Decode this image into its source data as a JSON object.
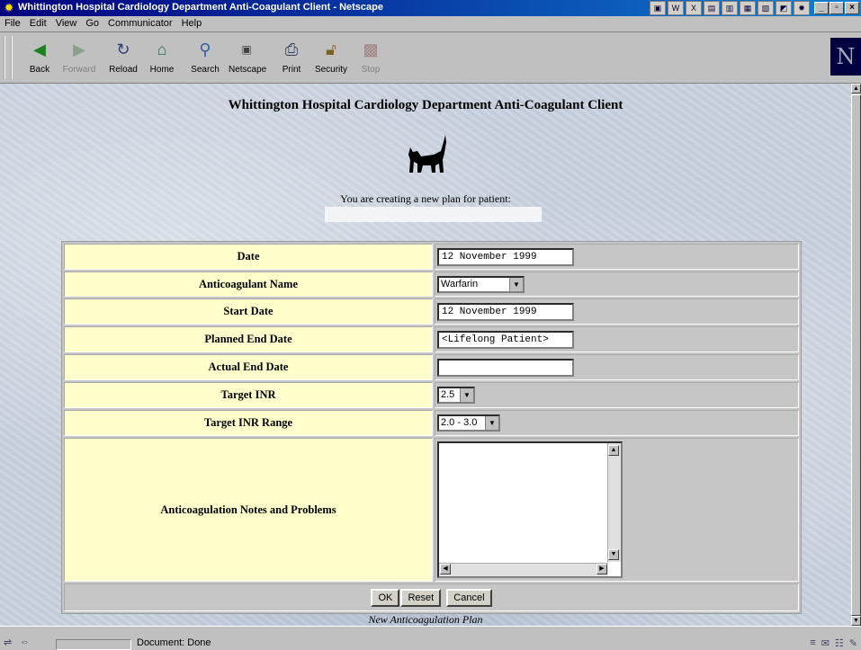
{
  "window": {
    "title": "Whittington Hospital Cardiology Department Anti-Coagulant Client - Netscape"
  },
  "menu": [
    "File",
    "Edit",
    "View",
    "Go",
    "Communicator",
    "Help"
  ],
  "toolbar": {
    "back": "Back",
    "forward": "Forward",
    "reload": "Reload",
    "home": "Home",
    "search": "Search",
    "netscape": "Netscape",
    "print": "Print",
    "security": "Security",
    "stop": "Stop"
  },
  "page": {
    "title": "Whittington Hospital Cardiology Department Anti-Coagulant Client",
    "intro": "You are creating a new plan for patient:",
    "caption": "New Anticoagulation Plan"
  },
  "form": {
    "date_label": "Date",
    "date_value": "12 November 1999",
    "anticoagulant_label": "Anticoagulant Name",
    "anticoagulant_value": "Warfarin",
    "start_label": "Start Date",
    "start_value": "12 November 1999",
    "planned_end_label": "Planned End Date",
    "planned_end_value": "<Lifelong Patient>",
    "actual_end_label": "Actual End Date",
    "actual_end_value": "",
    "target_inr_label": "Target INR",
    "target_inr_value": "2.5",
    "target_range_label": "Target INR Range",
    "target_range_value": "2.0 - 3.0",
    "notes_label": "Anticoagulation Notes and Problems"
  },
  "actions": {
    "ok": "OK",
    "reset": "Reset",
    "cancel": "Cancel"
  },
  "status": {
    "text": "Document: Done"
  }
}
